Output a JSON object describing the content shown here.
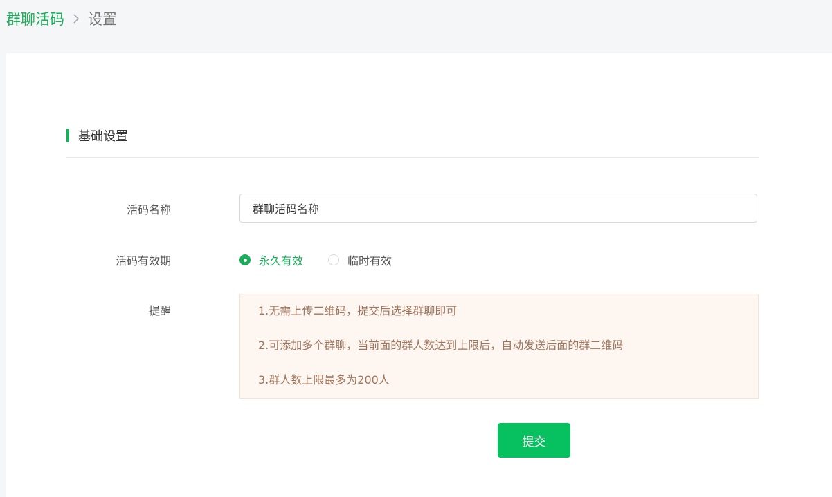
{
  "breadcrumb": {
    "parent": "群聊活码",
    "current": "设置"
  },
  "section": {
    "title": "基础设置"
  },
  "form": {
    "name_label": "活码名称",
    "name_value": "群聊活码名称",
    "validity_label": "活码有效期",
    "validity_options": [
      {
        "label": "永久有效",
        "checked": true
      },
      {
        "label": "临时有效",
        "checked": false
      }
    ],
    "tips_label": "提醒",
    "tips": [
      "1.无需上传二维码，提交后选择群聊即可",
      "2.可添加多个群聊，当前面的群人数达到上限后，自动发送后面的群二维码",
      "3.群人数上限最多为200人"
    ],
    "submit_label": "提交"
  },
  "colors": {
    "accent": "#1aad5a",
    "button": "#07c160",
    "tips_bg": "#fef6f0",
    "tips_text": "#a0755e"
  }
}
